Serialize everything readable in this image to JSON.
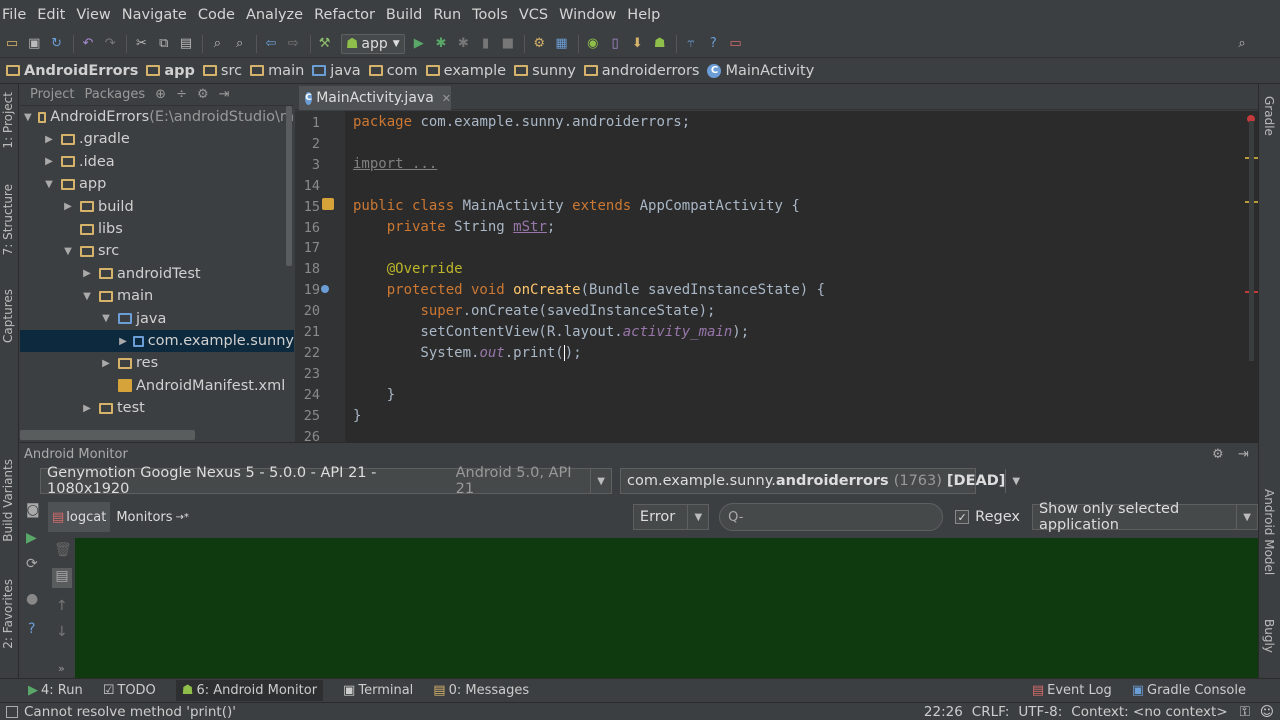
{
  "menu": [
    "File",
    "Edit",
    "View",
    "Navigate",
    "Code",
    "Analyze",
    "Refactor",
    "Build",
    "Run",
    "Tools",
    "VCS",
    "Window",
    "Help"
  ],
  "toolbar": {
    "run_config": "app"
  },
  "breadcrumbs": [
    "AndroidErrors",
    "app",
    "src",
    "main",
    "java",
    "com",
    "example",
    "sunny",
    "androiderrors",
    "MainActivity"
  ],
  "left_tabs": {
    "project": "1: Project",
    "structure": "7: Structure",
    "captures": "Captures",
    "build_variants": "Build Variants",
    "favorites": "2: Favorites"
  },
  "right_tabs": {
    "gradle": "Gradle",
    "android_model": "Android Model",
    "bugly": "Bugly"
  },
  "project_panel": {
    "tab_project": "Project",
    "tab_packages": "Packages",
    "tree": [
      {
        "label": "AndroidErrors",
        "extra": " (E:\\androidStudio\\m",
        "level": 0,
        "arrow": "▼",
        "icon": "folder-icon"
      },
      {
        "label": ".gradle",
        "level": 1,
        "arrow": "▶",
        "icon": "folder-icon"
      },
      {
        "label": ".idea",
        "level": 1,
        "arrow": "▶",
        "icon": "folder-icon"
      },
      {
        "label": "app",
        "level": 1,
        "arrow": "▼",
        "icon": "folder-icon"
      },
      {
        "label": "build",
        "level": 2,
        "arrow": "▶",
        "icon": "folder-icon"
      },
      {
        "label": "libs",
        "level": 2,
        "arrow": "",
        "icon": "folder-icon"
      },
      {
        "label": "src",
        "level": 2,
        "arrow": "▼",
        "icon": "folder-icon"
      },
      {
        "label": "androidTest",
        "level": 3,
        "arrow": "▶",
        "icon": "folder-icon"
      },
      {
        "label": "main",
        "level": 3,
        "arrow": "▼",
        "icon": "folder-icon"
      },
      {
        "label": "java",
        "level": 4,
        "arrow": "▼",
        "icon": "folder-icon"
      },
      {
        "label": "com.example.sunny",
        "level": 5,
        "arrow": "▶",
        "icon": "package-icon"
      },
      {
        "label": "res",
        "level": 4,
        "arrow": "▶",
        "icon": "folder-icon"
      },
      {
        "label": "AndroidManifest.xml",
        "level": 4,
        "arrow": "",
        "icon": "xml-icon"
      },
      {
        "label": "test",
        "level": 3,
        "arrow": "▶",
        "icon": "folder-icon"
      }
    ]
  },
  "editor": {
    "tab_label": "MainActivity.java",
    "line_numbers": [
      "1",
      "2",
      "3",
      "14",
      "15",
      "16",
      "17",
      "18",
      "19",
      "20",
      "21",
      "22",
      "23",
      "24",
      "25",
      "26"
    ]
  },
  "android_monitor": {
    "title": "Android Monitor",
    "device": "Genymotion Google Nexus 5 - 5.0.0 - API 21 - 1080x1920",
    "device_detail": "Android 5.0, API 21",
    "process_prefix": "com.example.sunny.",
    "process_bold": "androiderrors",
    "process_pid": "(1763)",
    "process_state": "[DEAD]",
    "tab_logcat": "logcat",
    "tab_monitors": "Monitors",
    "log_level": "Error",
    "search_placeholder": "Q-",
    "regex_label": "Regex",
    "filter": "Show only selected application"
  },
  "bottom_tabs": {
    "run": "4: Run",
    "todo": "TODO",
    "android_monitor": "6: Android Monitor",
    "terminal": "Terminal",
    "messages": "0: Messages",
    "event_log": "Event Log",
    "gradle_console": "Gradle Console"
  },
  "status": {
    "message": "Cannot resolve method 'print()'",
    "position": "22:26",
    "line_sep": "CRLF:",
    "encoding": "UTF-8:",
    "context": "Context: <no context>"
  },
  "colors": {
    "log_bg": "#0f3a0f",
    "selection": "#0d293e"
  }
}
